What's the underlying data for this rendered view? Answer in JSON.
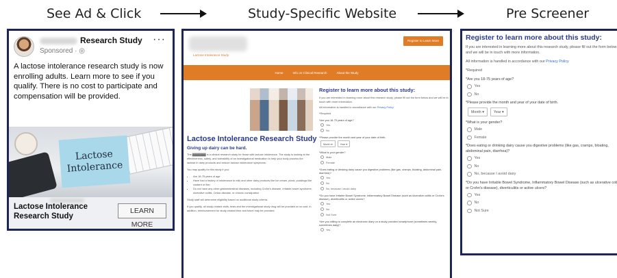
{
  "steps": {
    "ad": "See Ad & Click",
    "site": "Study-Specific Website",
    "pre": "Pre Screener"
  },
  "ad": {
    "name": "Research Study",
    "sponsored": "Sponsored · ◎",
    "more_icon": "···",
    "text": "A lactose intolerance research study is now enrolling adults. Learn more to see if you qualify. There is no cost to participate and compensation will be provided.",
    "image_note": "Lactose\nIntolerance",
    "footer_title": "Lactose Intolerance Research Study",
    "cta": "LEARN MORE"
  },
  "site": {
    "logo_sub": "Lactose Intolerance Study",
    "header_cta": "Register to Learn More",
    "nav": [
      "Home",
      "Info on Clinical Research",
      "About the Study"
    ],
    "h1": "Lactose Intolerance Research Study",
    "h2": "Giving up dairy can be hard.",
    "intro": "The ▓▓▓▓▓▓▓ is a clinical research study for those with lactose intolerance. The study is looking at the effectiveness, safety, and tolerability of an investigational medication to help your body process the lactose in dairy products and reduce lactose intolerance symptoms.",
    "qualify_lead": "You may qualify for this study if you:",
    "qualify": [
      "Are 18-75 years of age",
      "Have had a history of intolerance to milk and other dairy products like ice cream, pizza, puddings like custard or flan",
      "Do not have any other gastrointestinal diseases, including Crohn's disease, irritable bowel syndrome, ulcerative colitis, Celiac disease, or chronic constipation"
    ],
    "staff_note": "Study staff will determine eligibility based on additional study criteria.",
    "cost_note": "If you qualify, all study-related visits, tests and the investigational study drug will be provided at no cost. In addition, reimbursement for study-related time and travel may be provided.",
    "form": {
      "title": "Register to learn more about this study:",
      "intro": "If you are interested in learning more about this research study, please fill out the form below and we will be in touch with more information.",
      "privacy_pre": "All information is handled in accordance with our ",
      "privacy_link": "Privacy Policy",
      "required": "*Required",
      "q1": "*Are you 18-75 years of age?",
      "q1_opts": [
        "Yes",
        "No"
      ],
      "q2": "*Please provide the month and year of your date of birth.",
      "month": "Month ▾",
      "year": "Year ▾",
      "q3": "*What is your gender?",
      "q3_opts": [
        "Male",
        "Female"
      ],
      "q4": "*Does eating or drinking dairy cause you digestive problems (like gas, cramps, bloating, abdominal pain, diarrhea)?",
      "q4_opts": [
        "Yes",
        "No",
        "No, because I avoid dairy"
      ],
      "q5": "*Do you have Irritable Bowel Syndrome, Inflammatory Bowel Disease (such as ulcerative colitis or Crohn's disease), diverticulitis or active ulcers?",
      "q5_opts": [
        "Yes",
        "No",
        "Not Sure"
      ],
      "q6": "*Are you willing to complete an electronic diary on a study provided smartphone (sometimes weekly, sometimes daily)?",
      "q6_opts": [
        "Yes"
      ]
    }
  },
  "pre": {
    "title": "Register to learn more about this study:",
    "intro": "If you are interested in learning more about this research study, please fill out the form below and we will be in touch with more information.",
    "privacy_pre": "All information is handled in accordance with our ",
    "privacy_link": "Privacy Policy",
    "required": "*Required",
    "q1": "*Are you 18-75 years of age?",
    "q1_opts": [
      "Yes",
      "No"
    ],
    "q2": "*Please provide the month and year of your date of birth.",
    "month": "Month ▾",
    "year": "Year ▾",
    "q3": "*What is your gender?",
    "q3_opts": [
      "Male",
      "Female"
    ],
    "q4": "*Does eating or drinking dairy cause you digestive problems (like gas, cramps, bloating, abdominal pain, diarrhea)?",
    "q4_opts": [
      "Yes",
      "No",
      "No, because I avoid dairy"
    ],
    "q5": "*Do you have Irritable Bowel Syndrome, Inflammatory Bowel Disease (such as ulcerative colitis or Crohn's disease), diverticulitis or active ulcers?",
    "q5_opts": [
      "Yes",
      "No",
      "Not Sure"
    ]
  },
  "colors": {
    "frame": "#1c2554",
    "brand_orange": "#e07b26",
    "heading_blue": "#2c3a8a",
    "link_blue": "#2c6ec8"
  }
}
